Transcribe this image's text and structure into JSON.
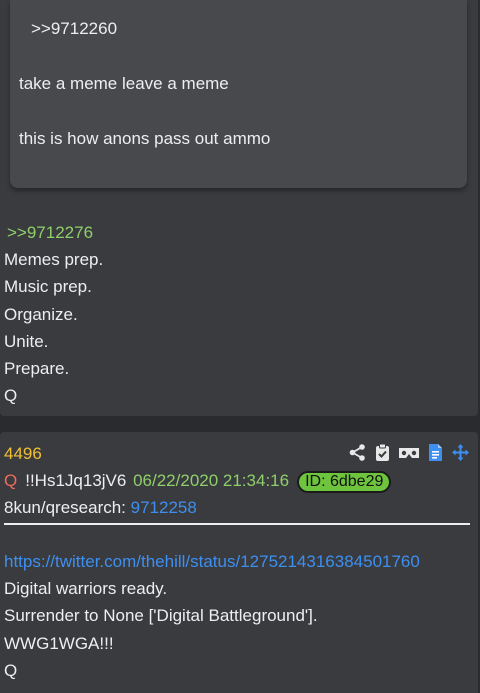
{
  "post1": {
    "quote": {
      "ref": ">>9712260",
      "line1": "take a meme leave a meme",
      "line2": "this is how anons pass out ammo"
    },
    "reply_ref": ">>9712276",
    "lines": [
      "Memes prep.",
      "Music prep.",
      "Organize.",
      "Unite.",
      "Prepare.",
      "Q"
    ]
  },
  "post2": {
    "number": "4496",
    "q_marker": "Q",
    "tripcode": "!!Hs1Jq13jV6",
    "datetime": "06/22/2020 21:34:16",
    "id_badge": "ID: 6dbe29",
    "board_label": "8kun/qresearch:",
    "board_link": "9712258",
    "url": "https://twitter.com/thehill/status/1275214316384501760",
    "lines": [
      "Digital warriors ready.",
      "Surrender to None ['Digital Battleground'].",
      "WWG1WGA!!!",
      "Q"
    ],
    "icons": [
      "share-icon",
      "clipboard-check-icon",
      "vr-goggles-icon",
      "document-icon",
      "move-arrows-icon"
    ]
  },
  "colors": {
    "background": "#2a2b2e",
    "post": "#3a3b3f",
    "quote_box": "#48494d",
    "green_text": "#8fcf6a",
    "link_blue": "#3d8ff0",
    "post_number": "#f2c034",
    "q_red": "#ef6b5a",
    "id_badge": "#6ec43d"
  }
}
